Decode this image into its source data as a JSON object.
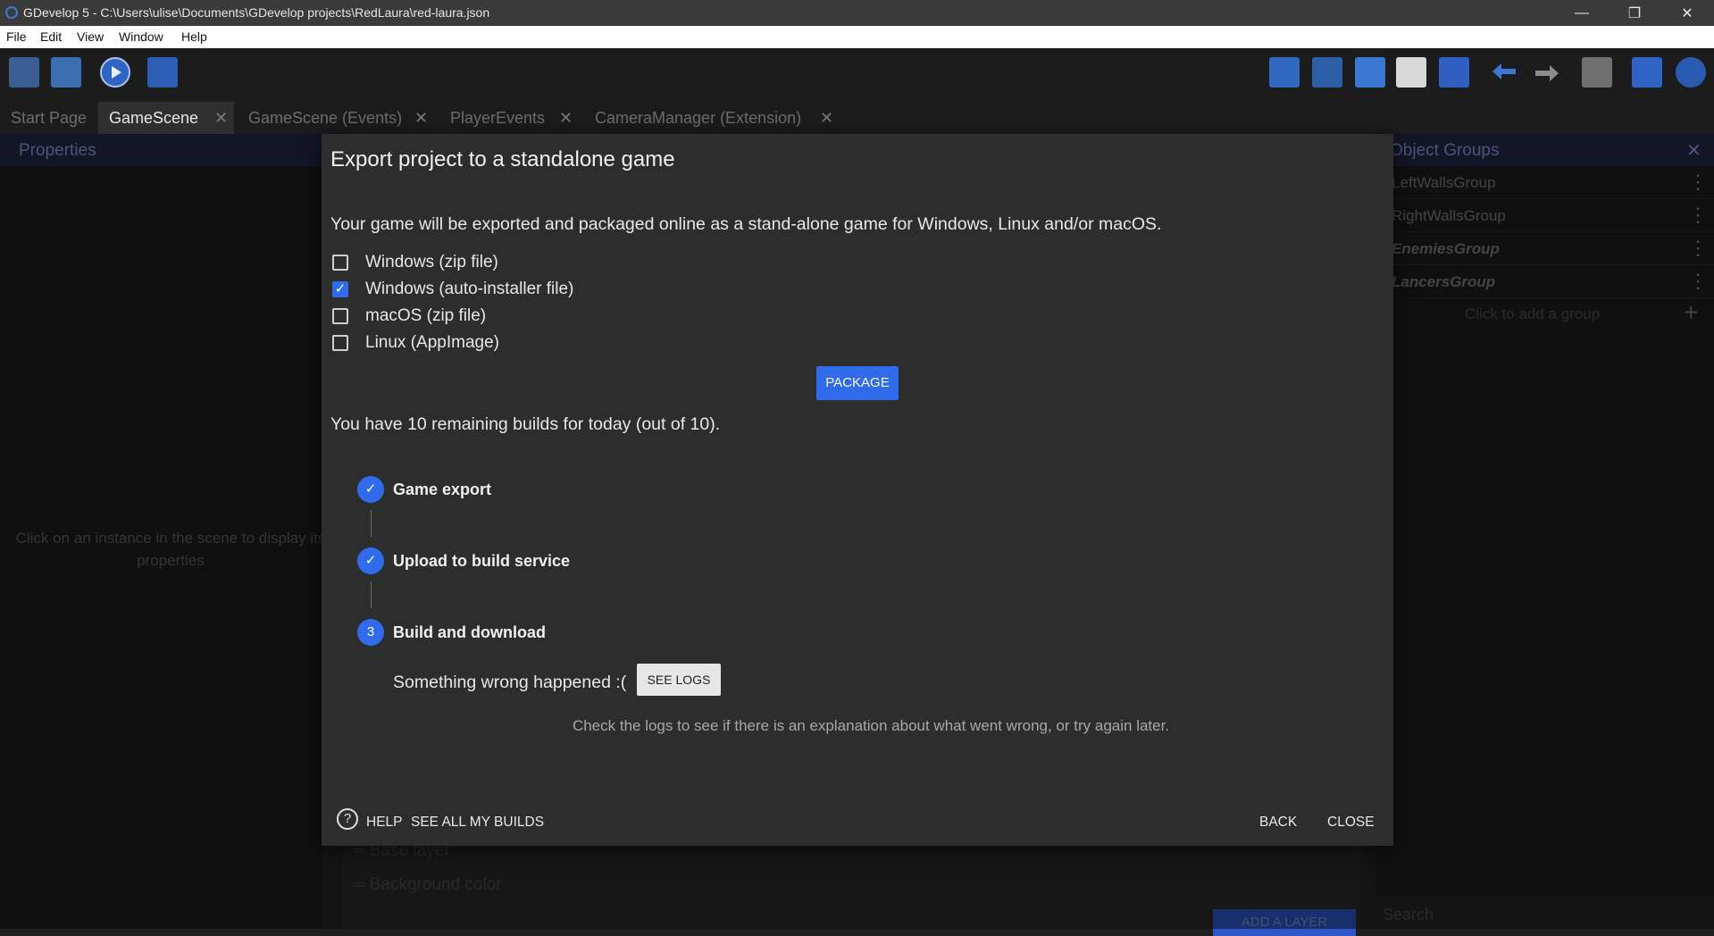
{
  "window": {
    "title": "GDevelop 5 - C:\\Users\\ulise\\Documents\\GDevelop projects\\RedLaura\\red-laura.json",
    "controls": {
      "minimize": "—",
      "restore": "❐",
      "close": "✕"
    }
  },
  "menu": [
    "File",
    "Edit",
    "View",
    "Window",
    "Help"
  ],
  "tabs": [
    {
      "label": "Start Page"
    },
    {
      "label": "GameScene",
      "close": "✕"
    },
    {
      "label": "GameScene (Events)",
      "close": "✕"
    },
    {
      "label": "PlayerEvents",
      "close": "✕"
    },
    {
      "label": "CameraManager (Extension)",
      "close": "✕"
    }
  ],
  "toolbar": {
    "left_icons": [
      "project-manager-icon",
      "scene-icon",
      "preview-play-icon",
      "debug-icon"
    ],
    "right_icons": [
      "objects-panel-icon",
      "object-groups-icon",
      "properties-icon",
      "instances-list-icon",
      "layers-icon",
      "undo-icon",
      "redo-icon",
      "window-mask-icon",
      "grid-icon",
      "zoom-reset-icon"
    ]
  },
  "properties_panel": {
    "title": "Properties",
    "hint": "Click on an instance in the scene to display its properties"
  },
  "layers_panel": {
    "rows": [
      "Base layer",
      "Background color"
    ],
    "add_layer": "ADD A LAYER"
  },
  "object_groups": {
    "title": "Object Groups",
    "close": "✕",
    "groups": [
      {
        "name": "LeftWallsGroup",
        "style": "normal"
      },
      {
        "name": "RightWallsGroup",
        "style": "normal"
      },
      {
        "name": "EnemiesGroup",
        "style": "italic"
      },
      {
        "name": "LancersGroup",
        "style": "italic"
      }
    ],
    "add_group": "Click to add a group",
    "add_icon": "+",
    "search_placeholder": "Search"
  },
  "dialog": {
    "title": "Export project to a standalone game",
    "description": "Your game will be exported and packaged online as a stand-alone game for Windows, Linux and/or macOS.",
    "targets": [
      {
        "label": "Windows (zip file)",
        "checked": false
      },
      {
        "label": "Windows (auto-installer file)",
        "checked": true
      },
      {
        "label": "macOS (zip file)",
        "checked": false
      },
      {
        "label": "Linux (AppImage)",
        "checked": false
      }
    ],
    "package_button": "PACKAGE",
    "remaining": "You have 10 remaining builds for today (out of 10).",
    "steps": [
      {
        "label": "Game export",
        "status": "done",
        "marker": "✓"
      },
      {
        "label": "Upload to build service",
        "status": "done",
        "marker": "✓"
      },
      {
        "label": "Build and download",
        "status": "active",
        "marker": "3"
      }
    ],
    "error_text": "Something wrong happened :(",
    "see_logs": "SEE LOGS",
    "hint": "Check the logs to see if there is an explanation about what went wrong, or try again later.",
    "footer": {
      "help": "HELP",
      "help_icon": "?",
      "see_all": "SEE ALL MY BUILDS",
      "back": "BACK",
      "close": "CLOSE"
    }
  },
  "colors": {
    "accent": "#2f6bea",
    "panel_header": "#25284a",
    "dialog_bg": "#2d2d2d"
  }
}
